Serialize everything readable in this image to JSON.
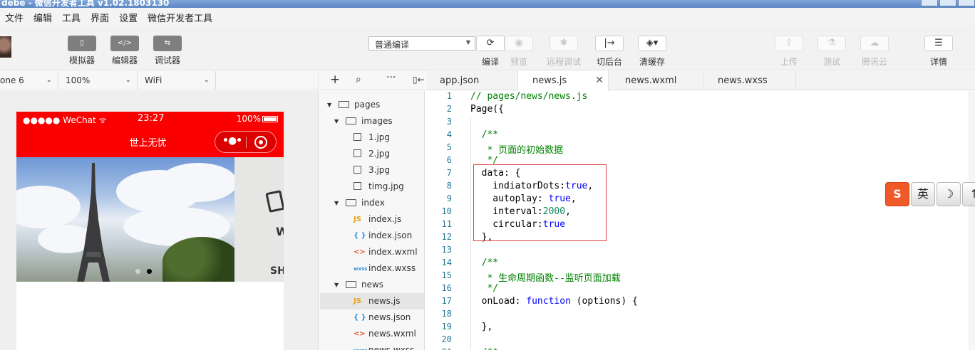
{
  "window": {
    "title": "debe - 微信开发者工具 v1.02.1803130"
  },
  "menu": [
    "文件",
    "编辑",
    "工具",
    "界面",
    "设置",
    "微信开发者工具"
  ],
  "toolbar": {
    "left": [
      {
        "label": "模拟器",
        "icon": "phone-icon"
      },
      {
        "label": "编辑器",
        "icon": "code-icon"
      },
      {
        "label": "调试器",
        "icon": "debug-icon"
      }
    ],
    "compile_mode": "普通编译",
    "center": [
      {
        "label": "编译",
        "icon": "refresh-icon",
        "enabled": true
      },
      {
        "label": "预览",
        "icon": "eye-icon",
        "enabled": false
      },
      {
        "label": "远程调试",
        "icon": "bug-icon",
        "enabled": false
      },
      {
        "label": "切后台",
        "icon": "switch-icon",
        "enabled": true
      },
      {
        "label": "清缓存",
        "icon": "layers-icon",
        "enabled": true
      }
    ],
    "right": [
      {
        "label": "上传",
        "icon": "upload-icon",
        "enabled": false
      },
      {
        "label": "测试",
        "icon": "flask-icon",
        "enabled": false
      },
      {
        "label": "腾讯云",
        "icon": "cloud-icon",
        "enabled": false
      },
      {
        "label": "详情",
        "icon": "menu-icon",
        "enabled": true
      }
    ]
  },
  "simulator_bar": {
    "device": "one 6",
    "zoom": "100%",
    "network": "WiFi"
  },
  "phone": {
    "carrier": "●●●●● WeChat",
    "wifi_icon": "wifi-icon",
    "time": "23:27",
    "battery": "100%",
    "nav_title": "世上无忧",
    "slide_text_1": "W",
    "slide_text_2": "SH",
    "swiper_active_index": 1,
    "swiper_count": 2
  },
  "tree": {
    "items": [
      {
        "name": "pages",
        "type": "folder",
        "depth": 0
      },
      {
        "name": "images",
        "type": "folder",
        "depth": 1
      },
      {
        "name": "1.jpg",
        "type": "image",
        "depth": 2
      },
      {
        "name": "2.jpg",
        "type": "image",
        "depth": 2
      },
      {
        "name": "3.jpg",
        "type": "image",
        "depth": 2
      },
      {
        "name": "timg.jpg",
        "type": "image",
        "depth": 2
      },
      {
        "name": "index",
        "type": "folder",
        "depth": 1
      },
      {
        "name": "index.js",
        "type": "js",
        "depth": 2
      },
      {
        "name": "index.json",
        "type": "json",
        "depth": 2
      },
      {
        "name": "index.wxml",
        "type": "wxml",
        "depth": 2
      },
      {
        "name": "index.wxss",
        "type": "wxss",
        "depth": 2
      },
      {
        "name": "news",
        "type": "folder",
        "depth": 1
      },
      {
        "name": "news.js",
        "type": "js",
        "depth": 2,
        "selected": true
      },
      {
        "name": "news.json",
        "type": "json",
        "depth": 2
      },
      {
        "name": "news.wxml",
        "type": "wxml",
        "depth": 2
      },
      {
        "name": "news.wxss",
        "type": "wxss",
        "depth": 2
      }
    ],
    "type_icons": {
      "js": "JS",
      "json": "{ }",
      "wxml": "<>",
      "wxss": "wxss"
    }
  },
  "tabs": [
    {
      "label": "app.json",
      "active": false
    },
    {
      "label": "news.js",
      "active": true
    },
    {
      "label": "news.wxml",
      "active": false
    },
    {
      "label": "news.wxss",
      "active": false
    }
  ],
  "code": [
    [
      [
        "cm",
        "// pages/news/news.js"
      ]
    ],
    [
      [
        "",
        "Page({"
      ]
    ],
    [
      [
        "",
        ""
      ]
    ],
    [
      [
        "cm",
        "  /**"
      ]
    ],
    [
      [
        "cm",
        "   * 页面的初始数据"
      ]
    ],
    [
      [
        "cm",
        "   */"
      ]
    ],
    [
      [
        "",
        "  data: {"
      ]
    ],
    [
      [
        "",
        "    indiatorDots:"
      ],
      [
        "kw",
        "true"
      ],
      [
        "",
        ","
      ]
    ],
    [
      [
        "",
        "    autoplay: "
      ],
      [
        "kw",
        "true"
      ],
      [
        "",
        ","
      ]
    ],
    [
      [
        "",
        "    interval:"
      ],
      [
        "num",
        "2000"
      ],
      [
        "",
        ","
      ]
    ],
    [
      [
        "",
        "    circular:"
      ],
      [
        "kw",
        "true"
      ]
    ],
    [
      [
        "",
        "  },"
      ]
    ],
    [
      [
        "",
        ""
      ]
    ],
    [
      [
        "cm",
        "  /**"
      ]
    ],
    [
      [
        "cm",
        "   * 生命周期函数--监听页面加载"
      ]
    ],
    [
      [
        "cm",
        "   */"
      ]
    ],
    [
      [
        "",
        "  onLoad: "
      ],
      [
        "kw",
        "function"
      ],
      [
        "",
        " (options) {"
      ]
    ],
    [
      [
        "",
        ""
      ]
    ],
    [
      [
        "",
        "  },"
      ]
    ],
    [
      [
        "",
        ""
      ]
    ],
    [
      [
        "cm",
        "  /**"
      ]
    ]
  ],
  "ime": [
    "S",
    "英",
    "☽",
    "↑"
  ],
  "colors": {
    "wechat_red": "#fb0000",
    "comment": "#008000",
    "keyword": "#0000ff",
    "number": "#09885a",
    "highlight_box": "#e04040"
  }
}
